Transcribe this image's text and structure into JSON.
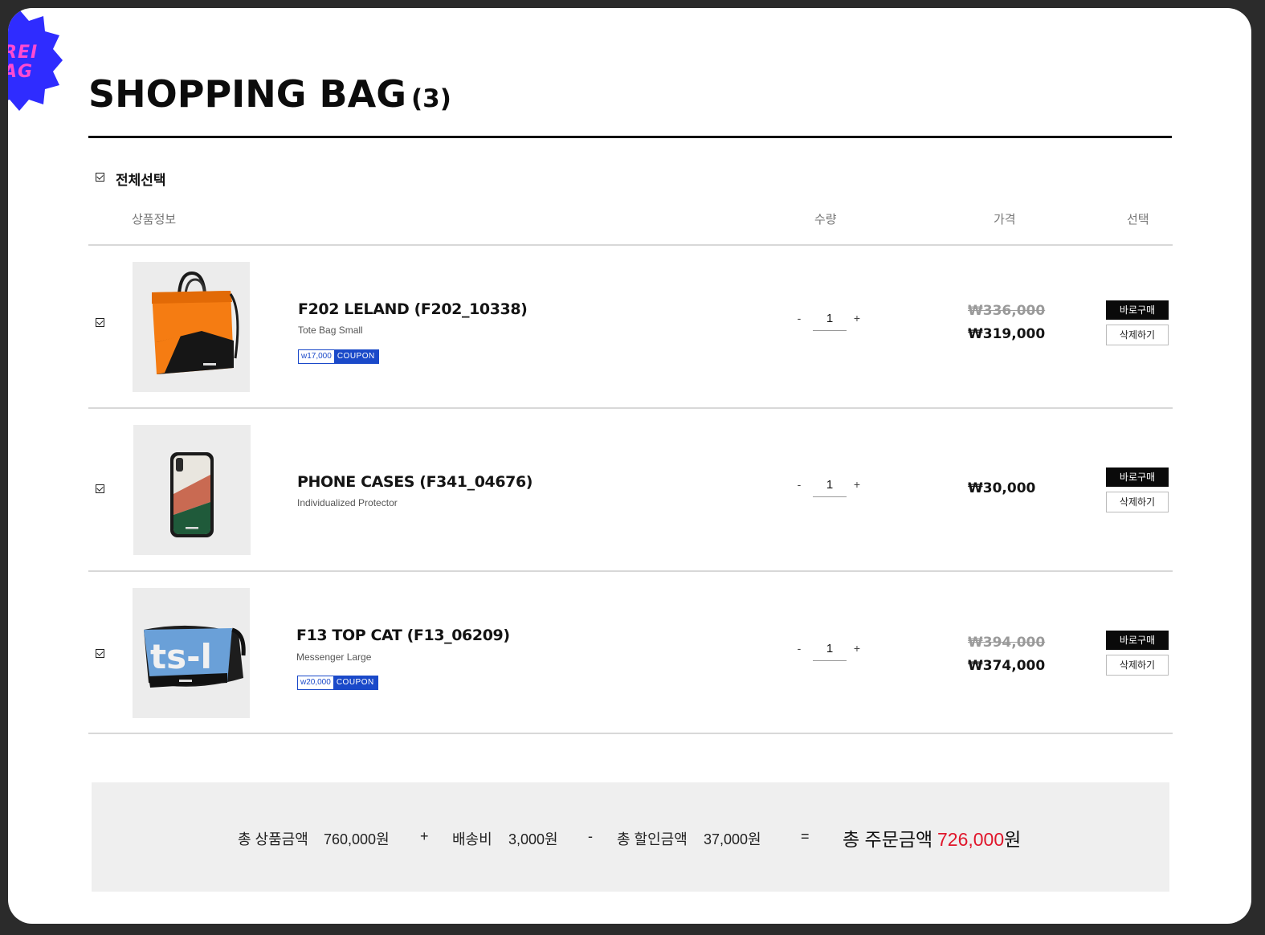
{
  "header": {
    "badge_text": "REI\nAG",
    "title": "SHOPPING BAG",
    "count": "(3)"
  },
  "select_all": {
    "label": "전체선택",
    "checked": true
  },
  "columns": {
    "product_info": "상품정보",
    "quantity": "수량",
    "price": "가격",
    "select": "선택"
  },
  "items": [
    {
      "name": "F202 LELAND (F202_10338)",
      "desc": "Tote Bag Small",
      "coupon_amount": "w17,000",
      "coupon_label": "COUPON",
      "quantity": "1",
      "qty_minus": "-",
      "qty_plus": "+",
      "price_original": "₩336,000",
      "price_final": "₩319,000",
      "buy_label": "바로구매",
      "delete_label": "삭제하기",
      "checked": true,
      "image_icon": "orange-tote-bag"
    },
    {
      "name": "PHONE CASES (F341_04676)",
      "desc": "Individualized Protector",
      "quantity": "1",
      "qty_minus": "-",
      "qty_plus": "+",
      "price_final": "₩30,000",
      "buy_label": "바로구매",
      "delete_label": "삭제하기",
      "checked": true,
      "image_icon": "phone-case"
    },
    {
      "name": "F13 TOP CAT (F13_06209)",
      "desc": "Messenger Large",
      "coupon_amount": "w20,000",
      "coupon_label": "COUPON",
      "quantity": "1",
      "qty_minus": "-",
      "qty_plus": "+",
      "price_original": "₩394,000",
      "price_final": "₩374,000",
      "buy_label": "바로구매",
      "delete_label": "삭제하기",
      "checked": true,
      "image_icon": "blue-messenger-bag"
    }
  ],
  "summary": {
    "subtotal_label": "총 상품금액",
    "subtotal_value": "760,000원",
    "plus": "+",
    "shipping_label": "배송비",
    "shipping_value": "3,000원",
    "minus": "-",
    "discount_label": "총 할인금액",
    "discount_value": "37,000원",
    "equals": "=",
    "total_label": "총 주문금액",
    "total_value": "726,000",
    "total_unit": "원"
  },
  "colors": {
    "accent_blue": "#1a49c9",
    "badge_blue": "#2f2cff",
    "badge_pink": "#ff4bd1",
    "total_red": "#e0162b"
  }
}
